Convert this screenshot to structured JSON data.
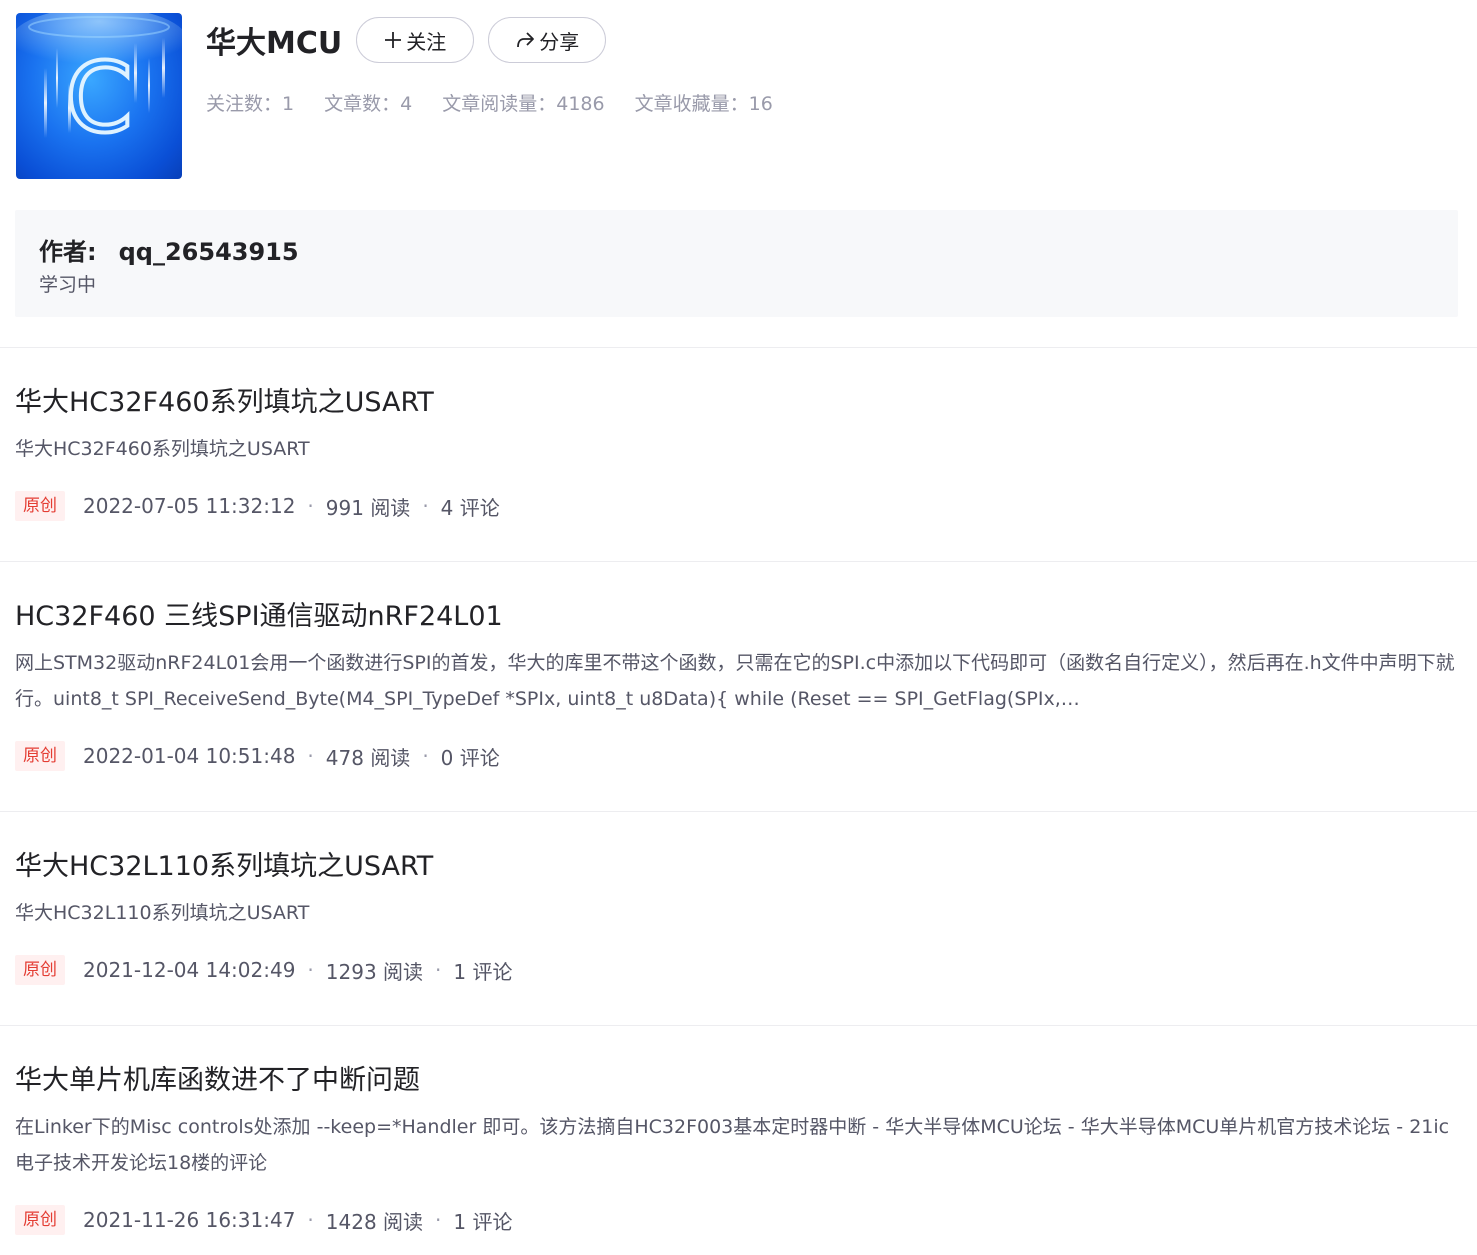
{
  "column": {
    "title": "华大MCU",
    "cover_letter": "C",
    "follow_label": "关注",
    "share_label": "分享",
    "stats": [
      {
        "label": "关注数：",
        "value": "1"
      },
      {
        "label": "文章数：",
        "value": "4"
      },
      {
        "label": "文章阅读量：",
        "value": "4186"
      },
      {
        "label": "文章收藏量：",
        "value": "16"
      }
    ]
  },
  "author": {
    "label": "作者:",
    "name": "qq_26543915",
    "bio": "学习中"
  },
  "articles": [
    {
      "title": "华大HC32F460系列填坑之USART",
      "desc": "华大HC32F460系列填坑之USART",
      "badge": "原创",
      "date": "2022-07-05 11:32:12",
      "reads": "991 阅读",
      "comments": "4 评论"
    },
    {
      "title": "HC32F460 三线SPI通信驱动nRF24L01",
      "desc": "网上STM32驱动nRF24L01会用一个函数进行SPI的首发，华大的库里不带这个函数，只需在它的SPI.c中添加以下代码即可（函数名自行定义），然后再在.h文件中声明下就行。uint8_t SPI_ReceiveSend_Byte(M4_SPI_TypeDef *SPIx, uint8_t u8Data){ while (Reset == SPI_GetFlag(SPIx,…",
      "badge": "原创",
      "date": "2022-01-04 10:51:48",
      "reads": "478 阅读",
      "comments": "0 评论"
    },
    {
      "title": "华大HC32L110系列填坑之USART",
      "desc": "华大HC32L110系列填坑之USART",
      "badge": "原创",
      "date": "2021-12-04 14:02:49",
      "reads": "1293 阅读",
      "comments": "1 评论"
    },
    {
      "title": "华大单片机库函数进不了中断问题",
      "desc": "在Linker下的Misc controls处添加 --keep=*Handler 即可。该方法摘自HC32F003基本定时器中断 - 华大半导体MCU论坛 - 华大半导体MCU单片机官方技术论坛 - 21ic电子技术开发论坛18楼的评论",
      "badge": "原创",
      "date": "2021-11-26 16:31:47",
      "reads": "1428 阅读",
      "comments": "1 评论"
    }
  ],
  "colors": {
    "badge_text": "#e43d33",
    "badge_bg": "#fff0f0",
    "stats_text": "#999aaa",
    "author_box_bg": "#f7f8fa"
  },
  "icons": {
    "follow": "plus-icon",
    "share": "share-arrow-icon"
  }
}
